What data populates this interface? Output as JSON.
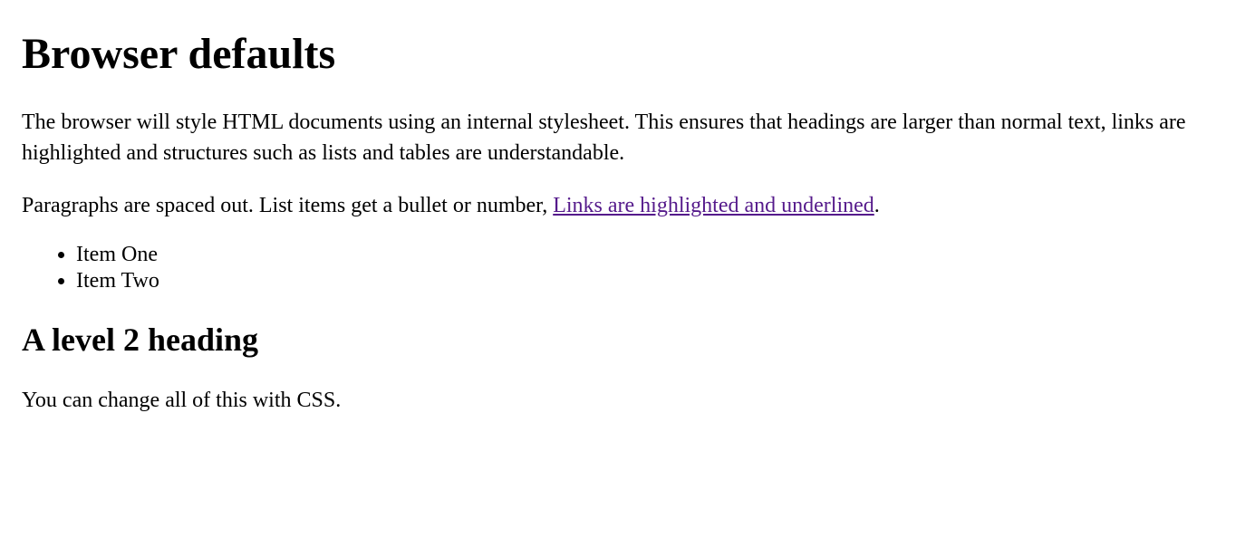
{
  "heading1": "Browser defaults",
  "paragraph1": "The browser will style HTML documents using an internal stylesheet. This ensures that headings are larger than normal text, links are highlighted and structures such as lists and tables are understandable.",
  "paragraph2_prefix": "Paragraphs are spaced out. List items get a bullet or number, ",
  "link_text": "Links are highlighted and underlined",
  "paragraph2_suffix": ".",
  "list_items": {
    "0": "Item One",
    "1": "Item Two"
  },
  "heading2": "A level 2 heading",
  "paragraph3": "You can change all of this with CSS."
}
